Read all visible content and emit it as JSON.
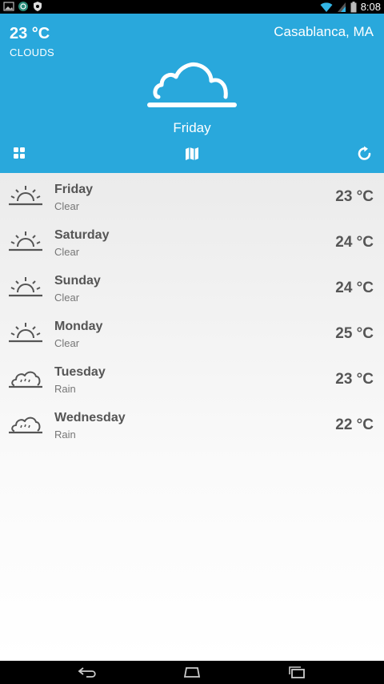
{
  "status_bar": {
    "time": "8:08"
  },
  "current": {
    "temperature": "23 °C",
    "condition": "CLOUDS",
    "city": "Casablanca, MA",
    "day": "Friday",
    "icon": "cloud-icon"
  },
  "colors": {
    "header": "#29a8dc",
    "text_dark": "#555555",
    "text_light": "#777777"
  },
  "forecast": [
    {
      "day": "Friday",
      "condition": "Clear",
      "temp": "23 °C",
      "icon": "sun-icon"
    },
    {
      "day": "Saturday",
      "condition": "Clear",
      "temp": "24 °C",
      "icon": "sun-icon"
    },
    {
      "day": "Sunday",
      "condition": "Clear",
      "temp": "24 °C",
      "icon": "sun-icon"
    },
    {
      "day": "Monday",
      "condition": "Clear",
      "temp": "25 °C",
      "icon": "sun-icon"
    },
    {
      "day": "Tuesday",
      "condition": "Rain",
      "temp": "23 °C",
      "icon": "rain-icon"
    },
    {
      "day": "Wednesday",
      "condition": "Rain",
      "temp": "22 °C",
      "icon": "rain-icon"
    }
  ]
}
